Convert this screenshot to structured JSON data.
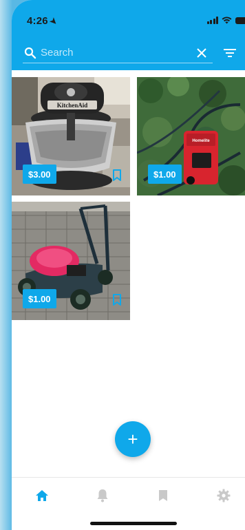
{
  "status_bar": {
    "time": "4:26"
  },
  "search": {
    "placeholder": "Search",
    "value": ""
  },
  "listings": [
    {
      "title": "KitchenAid stand mixer",
      "price": "$3.00",
      "brand_label": "KitchenAid"
    },
    {
      "title": "Pressure washer",
      "price": "$1.00",
      "brand_label": "Homelite"
    },
    {
      "title": "Lawn mower",
      "price": "$1.00"
    }
  ],
  "fab": {
    "icon": "plus-icon",
    "label": "+"
  },
  "tabbar": {
    "items": [
      {
        "icon": "home-icon",
        "active": true
      },
      {
        "icon": "bell-icon",
        "active": false
      },
      {
        "icon": "bookmark-icon",
        "active": false
      },
      {
        "icon": "gear-icon",
        "active": false
      }
    ]
  },
  "colors": {
    "primary": "#0fa8ea",
    "tab_inactive": "#c9c9c9",
    "background": "#5fbbe7"
  }
}
